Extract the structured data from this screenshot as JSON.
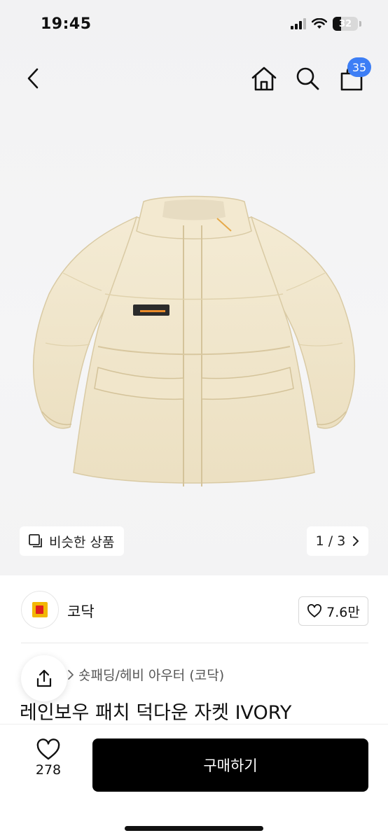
{
  "status_bar": {
    "time": "19:45",
    "battery": "32",
    "battery_level": 0.32
  },
  "nav": {
    "cart_count": "35"
  },
  "gallery": {
    "similar_label": "비슷한 상품",
    "page": "1 / 3"
  },
  "brand": {
    "name": "코닥",
    "likes": "7.6만"
  },
  "product": {
    "category": "숏패딩/헤비 아우터 (코닥)",
    "title": "레인보우 패치 덕다운 자켓 IVORY"
  },
  "actions": {
    "wish_count": "278",
    "buy_label": "구매하기"
  },
  "colors": {
    "accent": "#3d7ef5",
    "buy_button": "#000000",
    "jacket": "#f1e7cf"
  },
  "icons": [
    "chevron-left-icon",
    "home-icon",
    "search-icon",
    "bag-icon",
    "similar-icon",
    "chevron-right-icon",
    "heart-icon",
    "share-icon"
  ]
}
